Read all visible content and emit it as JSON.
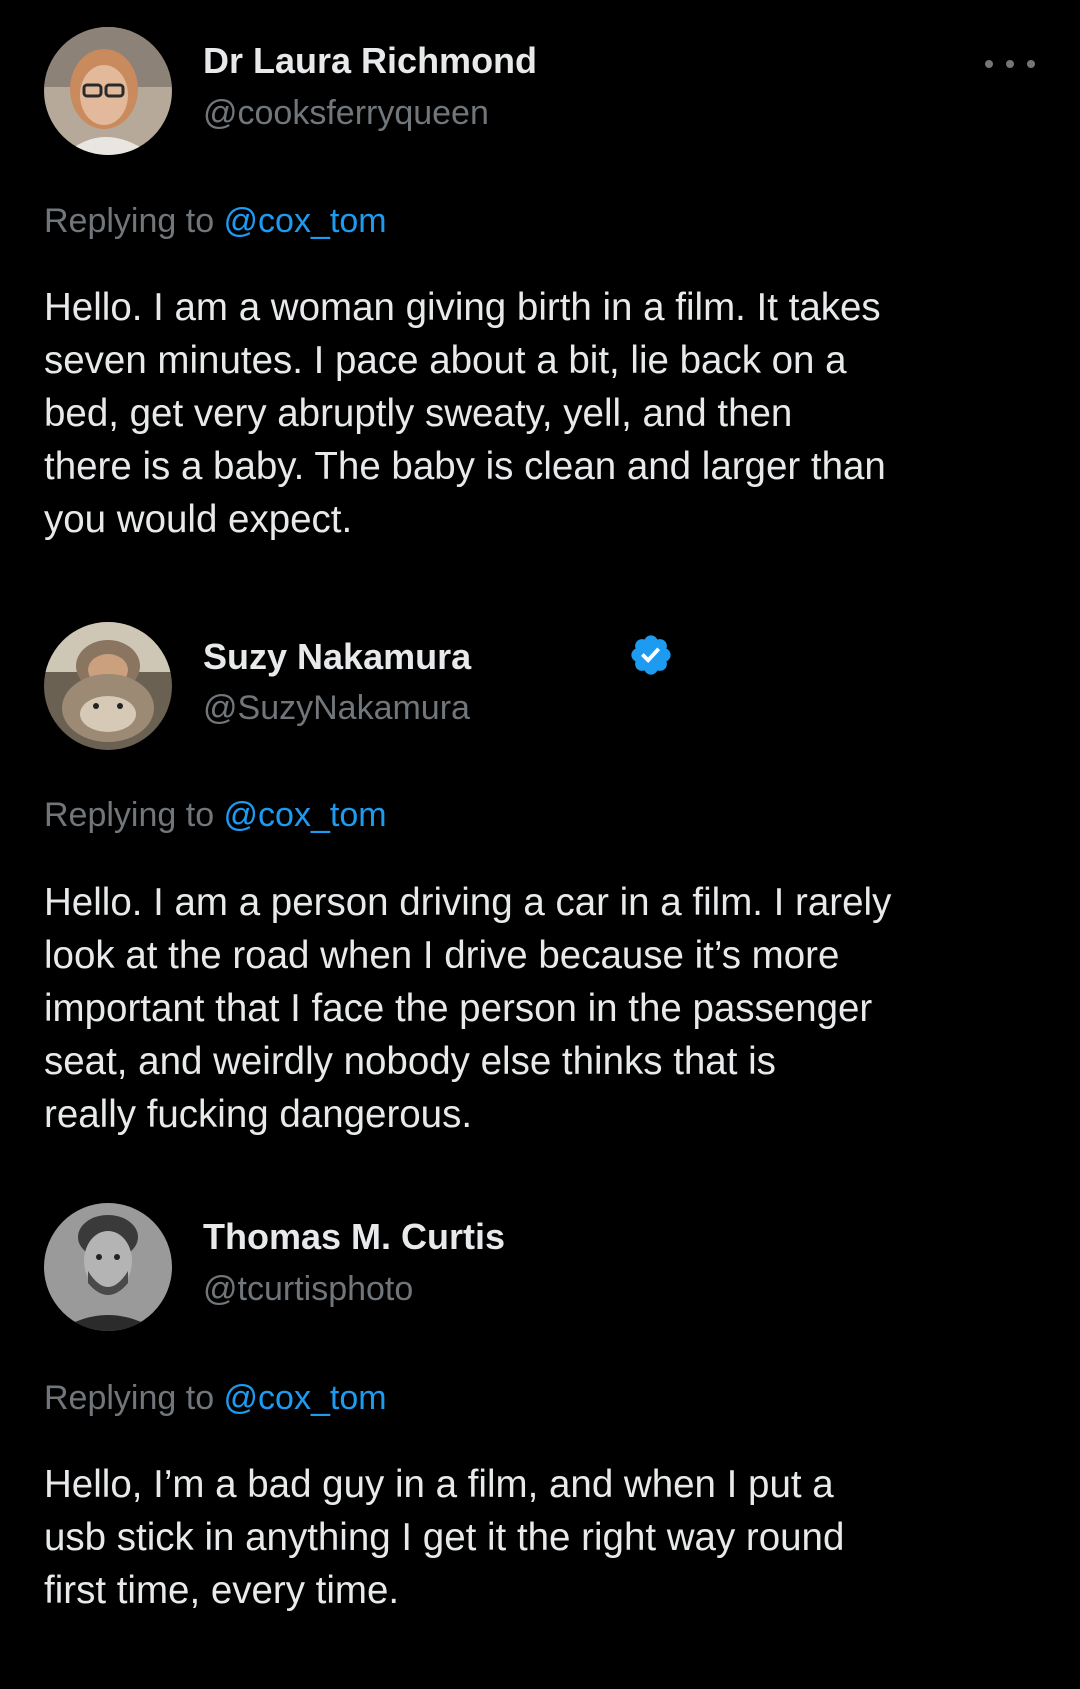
{
  "tweets": [
    {
      "display_name": "Dr Laura Richmond",
      "handle": "@cooksferryqueen",
      "replying_prefix": "Replying to ",
      "replying_to": "@cox_tom",
      "verified": false,
      "avatar_icon": "person-avatar",
      "body_lines": [
        "Hello. I am a woman giving birth in a film. It takes",
        "seven minutes. I pace about a bit, lie back on a",
        "bed, get very abruptly sweaty, yell, and then",
        "there is a baby. The baby is clean and larger than",
        "you would expect."
      ]
    },
    {
      "display_name": "Suzy Nakamura",
      "handle": "@SuzyNakamura",
      "replying_prefix": "Replying to ",
      "replying_to": "@cox_tom",
      "verified": true,
      "avatar_icon": "person-with-cat-avatar",
      "body_lines": [
        "Hello. I am a person driving a car in a film. I rarely",
        "look at the road when I drive because it’s more",
        "important that I face the person in the passenger",
        "seat, and weirdly nobody else thinks that is",
        "really fucking dangerous."
      ]
    },
    {
      "display_name": "Thomas M. Curtis",
      "handle": "@tcurtisphoto",
      "replying_prefix": "Replying to ",
      "replying_to": "@cox_tom",
      "verified": false,
      "avatar_icon": "person-avatar",
      "body_lines": [
        "Hello, I’m a bad guy in a film, and when I put a",
        "usb stick in anything I get it the right way round",
        "first time, every time."
      ]
    }
  ],
  "icons": {
    "more": "more-horizontal-icon",
    "verified": "verified-badge-icon"
  },
  "colors": {
    "background": "#000000",
    "primary_text": "#e7e9ea",
    "secondary_text": "#71767b",
    "link": "#1d9bf0",
    "verified": "#1d9bf0"
  }
}
